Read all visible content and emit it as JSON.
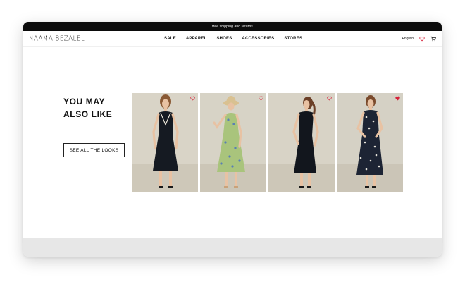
{
  "announcement": "free shipping and returns",
  "brand": {
    "logo_text": "NAAMA BEZALEL"
  },
  "nav": [
    {
      "label": "SALE"
    },
    {
      "label": "APPAREL"
    },
    {
      "label": "SHOES"
    },
    {
      "label": "ACCESSORIES"
    },
    {
      "label": "STORES"
    }
  ],
  "header": {
    "language": "English",
    "wishlist_icon": "heart-outline-icon",
    "cart_icon": "cart-icon",
    "heart_color": "#d6213a"
  },
  "section": {
    "heading_line1": "YOU MAY",
    "heading_line2": "ALSO LIKE",
    "cta_label": "SEE ALL THE LOOKS"
  },
  "products": [
    {
      "name": "black sleeveless dress with white trim",
      "wishlisted": false
    },
    {
      "name": "green floral sundress with straw hat",
      "wishlisted": false
    },
    {
      "name": "black sleeveless midi dress",
      "wishlisted": false
    },
    {
      "name": "navy floral print dress",
      "wishlisted": true
    }
  ]
}
